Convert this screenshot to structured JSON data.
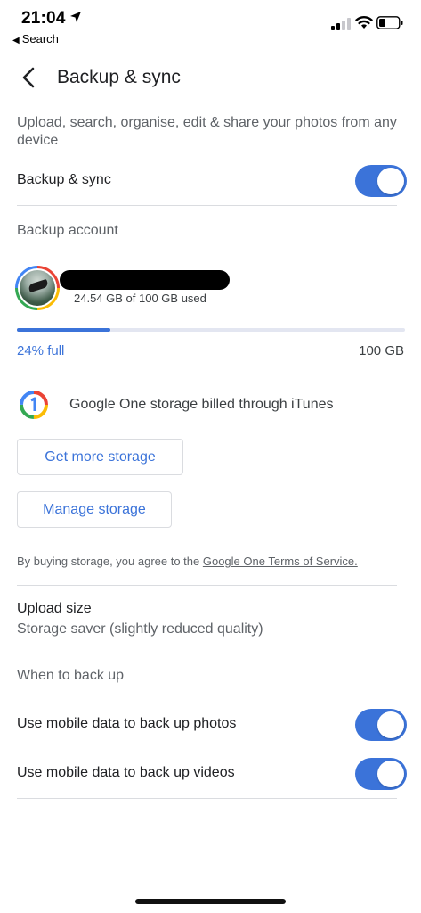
{
  "status_bar": {
    "time": "21:04",
    "back_app": "Search"
  },
  "header": {
    "title": "Backup & sync"
  },
  "description": "Upload, search, organise, edit & share your photos from any device",
  "backup_sync": {
    "label": "Backup & sync",
    "enabled": true
  },
  "backup_account": {
    "section_label": "Backup account",
    "usage_text": "24.54 GB of 100 GB used"
  },
  "storage": {
    "fill_fraction": 0.24,
    "percent_label": "24% full",
    "total_label": "100 GB",
    "billing_text": "Google One storage billed through iTunes",
    "get_more_label": "Get more storage",
    "manage_label": "Manage storage",
    "terms_prefix": "By buying storage, you agree to the ",
    "terms_link": "Google One Terms of Service."
  },
  "upload_size": {
    "title": "Upload size",
    "value": "Storage saver (slightly reduced quality)"
  },
  "when_to_backup": {
    "section_label": "When to back up",
    "photos_label": "Use mobile data to back up photos",
    "photos_enabled": true,
    "videos_label": "Use mobile data to back up videos",
    "videos_enabled": true
  },
  "colors": {
    "accent": "#3b73d9",
    "text_primary": "#202124",
    "text_secondary": "#5f6368",
    "divider": "#dadce0"
  }
}
